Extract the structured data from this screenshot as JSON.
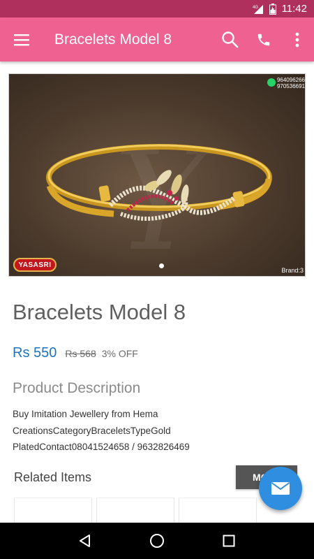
{
  "status_bar": {
    "network": "4G",
    "time": "11:42"
  },
  "app_bar": {
    "title": "Bracelets Model 8",
    "icons": [
      "menu-icon",
      "search-icon",
      "phone-icon",
      "more-vert-icon"
    ]
  },
  "hero": {
    "contact_numbers": [
      "964096266",
      "970536691"
    ],
    "brand_label": "Brand:3",
    "logo_text": "YASASRI",
    "watermark": "Yasasri"
  },
  "product": {
    "title": "Bracelets Model 8",
    "price": "Rs 550",
    "old_price": "Rs 568",
    "discount": "3% OFF",
    "description_heading": "Product Description",
    "description_lines": [
      "Buy Imitation Jewellery from Hema",
      "CreationsCategoryBraceletsTypeGold",
      "PlatedContact08041524658 / 9632826469"
    ]
  },
  "related": {
    "heading": "Related Items",
    "more_label": "MORE"
  },
  "colors": {
    "status_bar": "#b0305d",
    "app_bar": "#ee6191",
    "price": "#1e73be",
    "fab": "#2f8ee0",
    "more_button": "#555555"
  }
}
